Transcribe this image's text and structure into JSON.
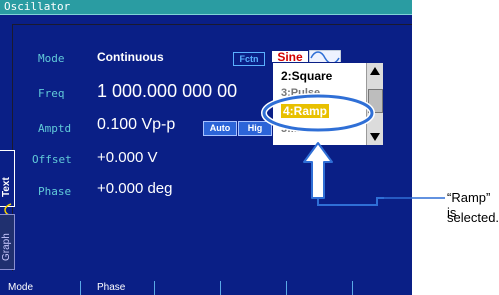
{
  "window": {
    "title": "Oscillator"
  },
  "params": [
    {
      "label": "Mode",
      "value": "Continuous"
    },
    {
      "label": "Freq",
      "value": "1 000.000 000 00"
    },
    {
      "label": "Amptd",
      "value": "0.100 Vp-p"
    },
    {
      "label": "Offset",
      "value": "+0.000 V"
    },
    {
      "label": "Phase",
      "value": "+0.000 deg"
    }
  ],
  "badges": {
    "fctn": "Fctn",
    "sine": "Sine",
    "auto": "Auto",
    "high": "Hig"
  },
  "dropdown": {
    "options": [
      "2:Square",
      "3:Pulse",
      "4:Ramp",
      "5:...."
    ],
    "selected": "4:Ramp",
    "scroll_up_icon": "triangle-up-icon",
    "scroll_down_icon": "triangle-down-icon"
  },
  "side_tabs": {
    "text": "Text",
    "graph": "Graph"
  },
  "softkeys": [
    "Mode",
    "Phase",
    "",
    "",
    "",
    ""
  ],
  "callout": {
    "line1": "“Ramp” is",
    "line2": "selected."
  },
  "colors": {
    "screen_bg": "#0a1f86",
    "titlebar_bg": "#2a9ca2",
    "label_cyan": "#61c9d8",
    "highlight": "#e8c000",
    "ellipse": "#2f6fd6",
    "arrow": "#2f6fd6"
  }
}
